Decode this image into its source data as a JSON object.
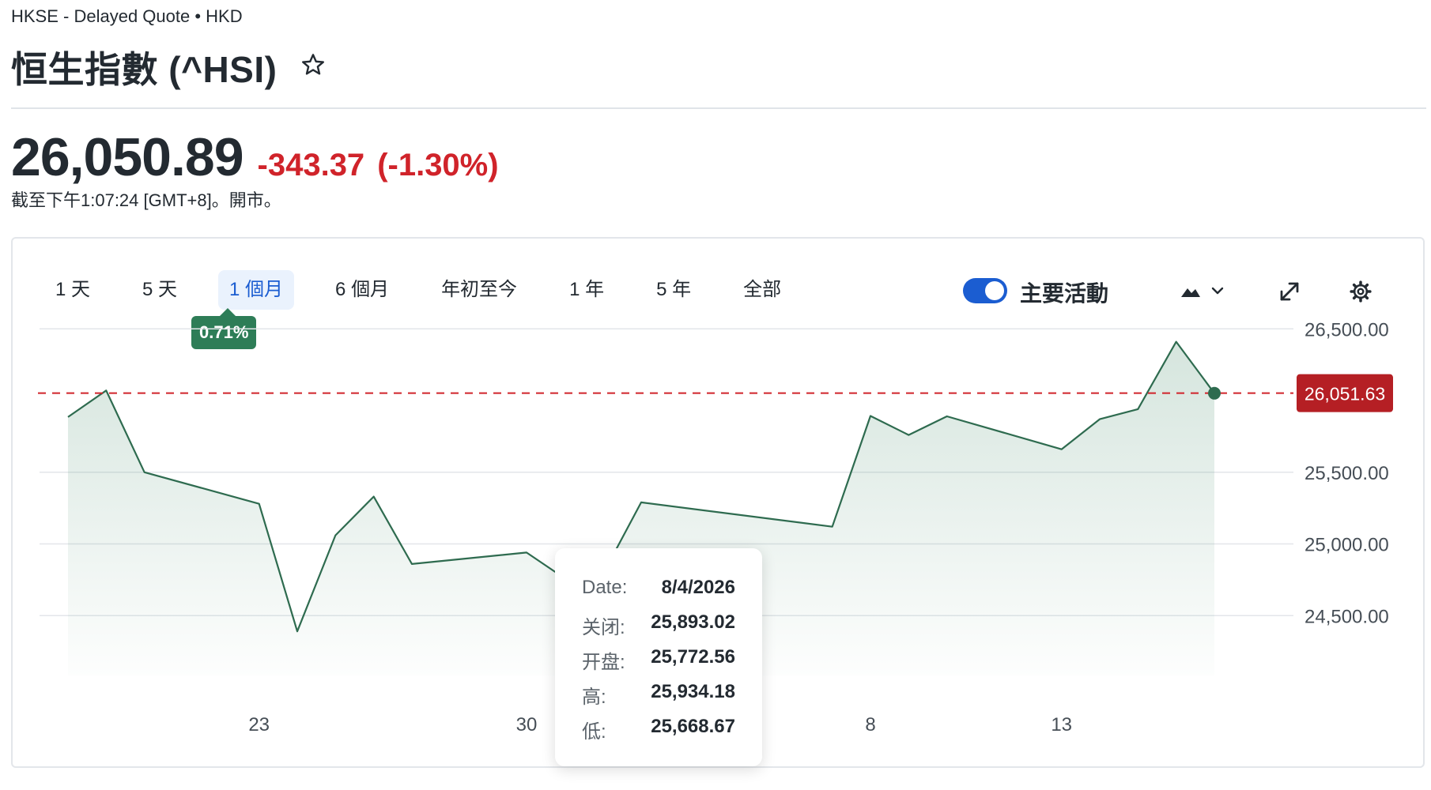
{
  "header": {
    "meta": "HKSE - Delayed Quote • HKD",
    "title": "恒生指數 (^HSI)",
    "price": "26,050.89",
    "change": "-343.37",
    "change_pct": "(-1.30%)",
    "market_time": "截至下午1:07:24 [GMT+8]。開市。"
  },
  "range_tabs": [
    {
      "label": "1 天"
    },
    {
      "label": "5 天"
    },
    {
      "label": "1 個月",
      "active": true
    },
    {
      "label": "6 個月"
    },
    {
      "label": "年初至今"
    },
    {
      "label": "1 年"
    },
    {
      "label": "5 年"
    },
    {
      "label": "全部"
    }
  ],
  "range_change": "0.71%",
  "controls": {
    "toggle_label": "主要活動",
    "toggle_on": true
  },
  "colors": {
    "line": "#2e6b4f",
    "area": "#2e7d57",
    "negative": "#d0232a",
    "accent": "#1b5dd1"
  },
  "icons": [
    "star-icon",
    "mountain-chart-icon",
    "chevron-down-icon",
    "expand-icon",
    "gear-icon"
  ],
  "chart_data": {
    "type": "area",
    "x": [
      "2026-03-18",
      "2026-03-19",
      "2026-03-20",
      "2026-03-23",
      "2026-03-24",
      "2026-03-25",
      "2026-03-26",
      "2026-03-27",
      "2026-03-30",
      "2026-03-31",
      "2026-04-01",
      "2026-04-02",
      "2026-04-07",
      "2026-04-08",
      "2026-04-09",
      "2026-04-10",
      "2026-04-13",
      "2026-04-14",
      "2026-04-15",
      "2026-04-16",
      "2026-04-17"
    ],
    "values": [
      25885,
      26070,
      25500,
      25280,
      24390,
      25060,
      25330,
      24860,
      24940,
      24760,
      24790,
      25290,
      25120,
      25893.02,
      25760,
      25890,
      25660,
      25870,
      25940,
      26410,
      26050.89
    ],
    "y_ticks": [
      24500,
      25000,
      25500,
      26500
    ],
    "y_tick_labels": [
      "24,500.00",
      "25,000.00",
      "25,500.00",
      "26,500.00"
    ],
    "x_tick_labels": [
      {
        "label": "23",
        "date": "2026-03-23"
      },
      {
        "label": "30",
        "date": "2026-03-30"
      },
      {
        "label": "8",
        "date": "2026-04-08"
      },
      {
        "label": "13",
        "date": "2026-04-13"
      }
    ],
    "month_label": {
      "label": "4月 '26",
      "date": "2026-04-01"
    },
    "ylim": [
      24000,
      26700
    ],
    "reference_line": {
      "value": 26051.63,
      "label": "26,051.63"
    },
    "last_point": 26050.89,
    "grid": true,
    "y_axis": "right",
    "tooltip": {
      "date_label": "Date:",
      "date": "8/4/2026",
      "close_label": "关闭:",
      "close": "25,893.02",
      "open_label": "开盘:",
      "open": "25,772.56",
      "high_label": "高:",
      "high": "25,934.18",
      "low_label": "低:",
      "low": "25,668.67"
    }
  }
}
